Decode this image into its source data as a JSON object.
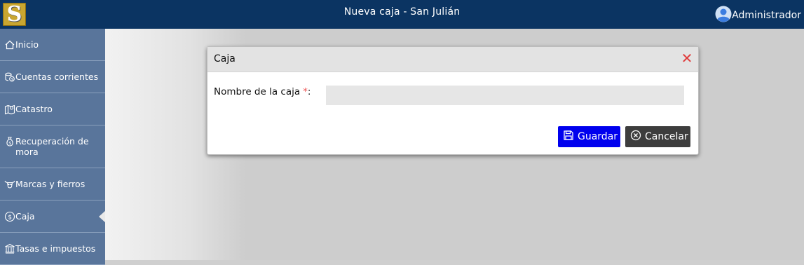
{
  "header": {
    "logo_letter": "S",
    "title": "Nueva caja - San Julián",
    "user_name": "Administrador"
  },
  "sidebar": {
    "items": [
      {
        "label": "Inicio",
        "icon": "home-icon"
      },
      {
        "label": "Cuentas corrientes",
        "icon": "coins-icon"
      },
      {
        "label": "Catastro",
        "icon": "map-pin-icon"
      },
      {
        "label": "Recuperación de mora",
        "icon": "money-bag-icon"
      },
      {
        "label": "Marcas y fierros",
        "icon": "cattle-icon"
      },
      {
        "label": "Caja",
        "icon": "dollar-circle-icon",
        "active": true
      },
      {
        "label": "Tasas e impuestos",
        "icon": "bank-icon"
      }
    ]
  },
  "modal": {
    "title": "Caja",
    "field_label": "Nombre de la caja",
    "required_mark": "*",
    "field_colon": ":",
    "field_value": "",
    "save_label": "Guardar",
    "cancel_label": "Cancelar"
  },
  "colors": {
    "header_bg": "#0b3462",
    "sidebar_bg": "#59759b",
    "save_bg": "#0000ee",
    "cancel_bg": "#3d3d3d",
    "close_color": "#e03b3b"
  }
}
